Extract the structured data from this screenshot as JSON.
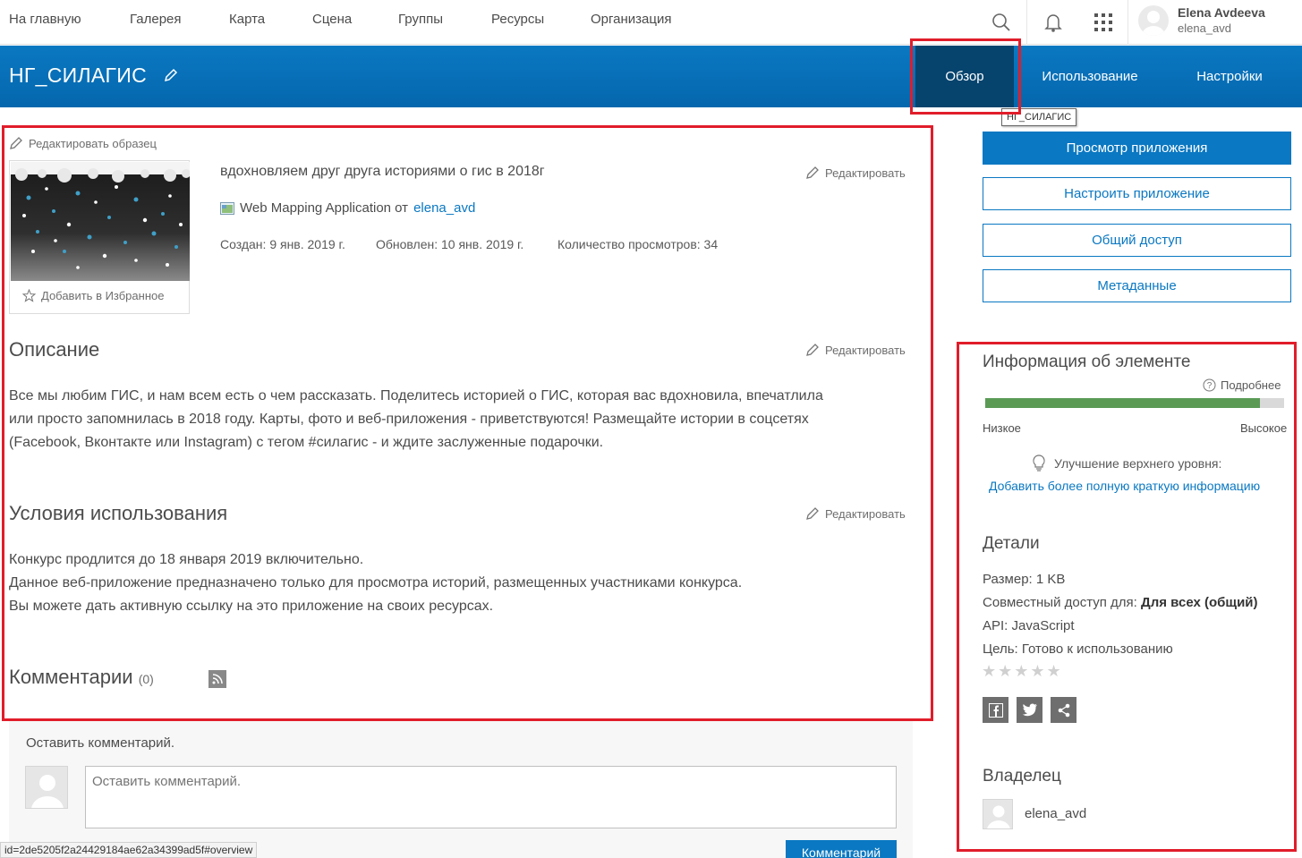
{
  "topnav": {
    "items": [
      "На главную",
      "Галерея",
      "Карта",
      "Сцена",
      "Группы",
      "Ресурсы",
      "Организация"
    ],
    "user": {
      "name": "Elena Avdeeva",
      "login": "elena_avd"
    },
    "icons": [
      "search-icon",
      "bell-icon",
      "apps-grid-icon",
      "avatar"
    ]
  },
  "header": {
    "title": "НГ_СИЛАГИС",
    "tabs": [
      "Обзор",
      "Использование",
      "Настройки"
    ],
    "active_tab": "Обзор",
    "tooltip": "НГ_СИЛАГИС",
    "colors": {
      "bar": "#0a78c2",
      "active_tab": "#06446e"
    }
  },
  "item": {
    "edit_thumbnail": "Редактировать образец",
    "add_favorite": "Добавить в Избранное",
    "snippet": "вдохновляем друг друга историями о гис в 2018г",
    "edit": "Редактировать",
    "type_text": "Web Mapping Application от",
    "owner_link": "elena_avd",
    "created": "Создан: 9 янв. 2019 г.",
    "updated": "Обновлен: 10 янв. 2019 г.",
    "views": "Количество просмотров: 34"
  },
  "description": {
    "heading": "Описание",
    "edit": "Редактировать",
    "lines": [
      "Все мы любим ГИС, и нам всем есть о чем рассказать. Поделитесь историей о ГИС, которая вас вдохновила, впечатлила",
      "или просто запомнилась в 2018 году. Карты, фото и веб-приложения - приветствуются! Размещайте истории в соцсетях",
      "(Facebook, Вконтакте или Instagram) с тегом #силагис - и ждите заслуженные подарочки."
    ]
  },
  "terms": {
    "heading": "Условия использования",
    "edit": "Редактировать",
    "lines": [
      "Конкурс продлится до 18 января 2019 включительно.",
      "Данное веб-приложение предназначено только для просмотра историй, размещенных участниками конкурса.",
      "Вы можете дать активную ссылку на это приложение на своих ресурсах."
    ]
  },
  "comments": {
    "heading": "Комментарии",
    "count": "(0)",
    "label": "Оставить комментарий.",
    "placeholder": "Оставить комментарий.",
    "button": "Комментарий"
  },
  "status_url": "id=2de5205f2a24429184ae62a34399ad5f#overview",
  "sidebar": {
    "view_app": "Просмотр приложения",
    "configure_app": "Настроить приложение",
    "share": "Общий доступ",
    "metadata": "Метаданные",
    "info_heading": "Информация об элементе",
    "more": "Подробнее",
    "quality_fraction": 0.92,
    "low": "Низкое",
    "high": "Высокое",
    "tip_label": "Улучшение верхнего уровня:",
    "tip_link": "Добавить более полную краткую информацию",
    "details_heading": "Детали",
    "size_label": "Размер:",
    "size_value": "1 KB",
    "shared_label": "Совместный доступ для:",
    "shared_value": "Для всех (общий)",
    "api_label": "API:",
    "api_value": "JavaScript",
    "purpose_label": "Цель:",
    "purpose_value": "Готово к использованию",
    "rating": 0,
    "stars": "★★★★★",
    "social": [
      "facebook-icon",
      "twitter-icon",
      "share-icon"
    ],
    "owner_heading": "Владелец",
    "owner": "elena_avd"
  }
}
